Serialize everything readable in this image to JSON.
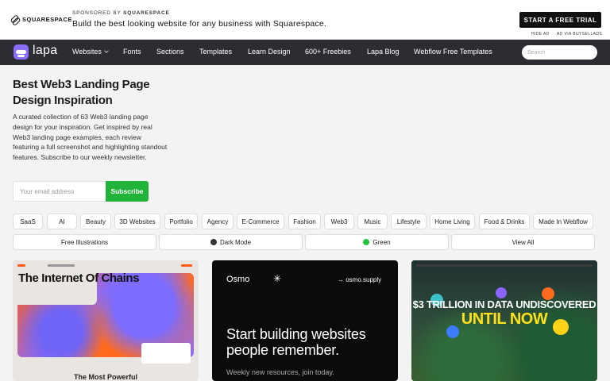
{
  "ad": {
    "brand": "SQUARESPACE",
    "sponsored_prefix": "SPONSORED BY",
    "sponsored_brand": "SQUARESPACE",
    "headline": "Build the best looking website for any business with Squarespace.",
    "cta": "START A FREE TRIAL",
    "hide_ad": "HIDE AD",
    "ad_via": "AD VIA BUYSELLADS"
  },
  "nav": {
    "logo": "lapa",
    "items": [
      "Websites",
      "Fonts",
      "Sections",
      "Templates",
      "Learn Design",
      "600+ Freebies",
      "Lapa Blog",
      "Webflow Free Templates"
    ],
    "search_placeholder": "Search"
  },
  "hero": {
    "title": "Best Web3 Landing Page Design Inspiration",
    "description": "A curated collection of 63 Web3 landing page design for your inspiration. Get inspired by real Web3 landing page examples, each review featuring a full screenshot and highlighting standout features. Subscribe to our weekly newsletter.",
    "email_placeholder": "Your email address",
    "subscribe": "Subscribe"
  },
  "tags": [
    "SaaS",
    "AI",
    "Beauty",
    "3D Websites",
    "Portfolio",
    "Agency",
    "E-Commerce",
    "Fashion",
    "Web3",
    "Music",
    "Lifestyle",
    "Home Living",
    "Food & Drinks",
    "Made In Webflow"
  ],
  "filters": [
    {
      "label": "Free Illustrations"
    },
    {
      "label": "Dark Mode",
      "dot_color": "#333333"
    },
    {
      "label": "Green",
      "dot_color": "#22c43a"
    },
    {
      "label": "View All"
    }
  ],
  "cards": [
    {
      "headline": "The Internet Of Chains",
      "subline": "The Most Powerful"
    },
    {
      "brand": "Osmo",
      "link": "→ osmo.supply",
      "headline": "Start building websites people remember.",
      "subline": "Weekly new resources, join today."
    },
    {
      "line1": "$3 TRILLION IN DATA UNDISCOVERED",
      "line2": "UNTIL NOW"
    }
  ],
  "colors": {
    "nav_bg": "#2b2d33",
    "accent_green": "#22b43a",
    "logo_purple": "#8a6cff"
  }
}
